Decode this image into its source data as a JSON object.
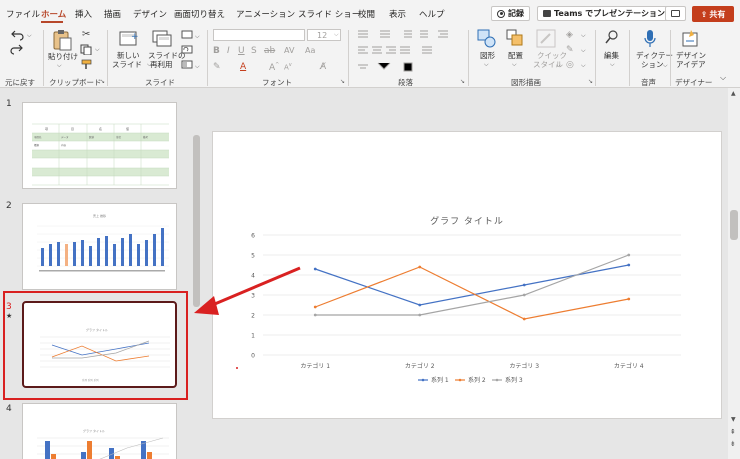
{
  "menu": {
    "tabs": [
      "ファイル",
      "ホーム",
      "挿入",
      "描画",
      "デザイン",
      "画面切り替え",
      "アニメーション",
      "スライド ショー",
      "校閲",
      "表示",
      "ヘルプ"
    ],
    "active": "ホーム",
    "record_label": "記録",
    "teams_label": "Teams でプレゼンテーション",
    "share_label": "共有"
  },
  "ribbon": {
    "undo_label": "元に戻す",
    "clipboard": {
      "paste_label": "貼り付け",
      "group_label": "クリップボード"
    },
    "slides": {
      "new_slide_label_1": "新しい",
      "new_slide_label_2": "スライド",
      "reuse_label_1": "スライドの",
      "reuse_label_2": "再利用",
      "group_label": "スライド"
    },
    "font": {
      "size_value": "12",
      "group_label": "フォント"
    },
    "paragraph": {
      "group_label": "段落"
    },
    "drawing": {
      "shape_label": "図形",
      "arrange_label": "配置",
      "quick_style_label_1": "クイック",
      "quick_style_label_2": "スタイル",
      "group_label": "図形描画"
    },
    "editing": {
      "label": "編集"
    },
    "voice": {
      "dictate_label_1": "ディクテー",
      "dictate_label_2": "ション",
      "group_label": "音声"
    },
    "designer": {
      "label_1": "デザイン",
      "label_2": "アイデア",
      "group_label": "デザイナー"
    }
  },
  "thumbnails": {
    "numbers": [
      "1",
      "2",
      "3",
      "4"
    ],
    "t1_headers": [
      "項",
      "目",
      "名",
      "値"
    ],
    "t1_row1": [
      "項目名",
      "データ",
      "数値",
      "単位",
      "備考"
    ],
    "t1_row2": [
      "種類",
      "内容"
    ],
    "t2_title": "売上 推移",
    "t3_title": "グラフ タイトル",
    "t3_legend": "系列 系列 系列",
    "t4_title": "グラフ タイトル"
  },
  "colors": {
    "accent": "#b7472a",
    "series1": "#4472c4",
    "series2": "#ed7d31",
    "series3": "#a5a5a5",
    "highlight": "#d92121"
  },
  "chart_data": {
    "type": "line",
    "title": "グラフ タイトル",
    "categories": [
      "カテゴリ 1",
      "カテゴリ 2",
      "カテゴリ 3",
      "カテゴリ 4"
    ],
    "series": [
      {
        "name": "系列 1",
        "values": [
          4.3,
          2.5,
          3.5,
          4.5
        ]
      },
      {
        "name": "系列 2",
        "values": [
          2.4,
          4.4,
          1.8,
          2.8
        ]
      },
      {
        "name": "系列 3",
        "values": [
          2,
          2,
          3,
          5
        ]
      }
    ],
    "ylim": [
      0,
      6
    ],
    "yticks": [
      "0",
      "1",
      "2",
      "3",
      "4",
      "5",
      "6"
    ],
    "legend": "bottom",
    "grid": true
  }
}
